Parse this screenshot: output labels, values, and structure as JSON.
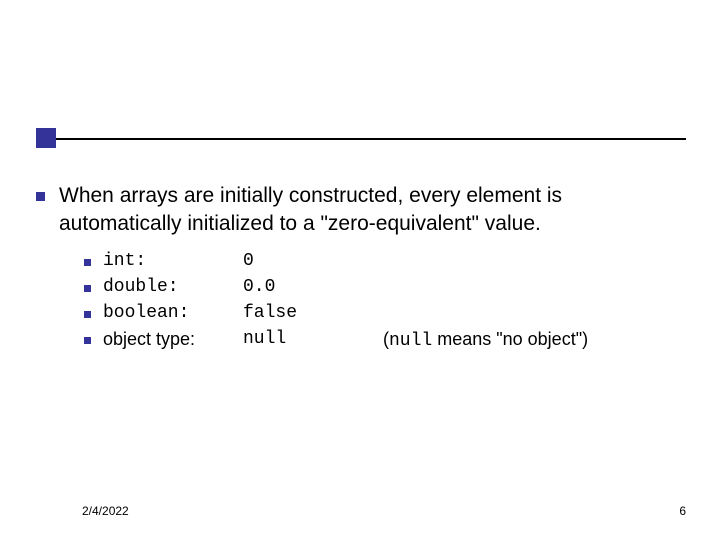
{
  "accent_color": "#333399",
  "main": {
    "text": "When arrays are initially constructed, every element is automatically initialized to a \"zero-equivalent\" value."
  },
  "rows": [
    {
      "type_label": "int:",
      "type_mono": true,
      "value": "0",
      "note_prefix": "",
      "note_mono": "",
      "note_suffix": ""
    },
    {
      "type_label": "double:",
      "type_mono": true,
      "value": "0.0",
      "note_prefix": "",
      "note_mono": "",
      "note_suffix": ""
    },
    {
      "type_label": "boolean:",
      "type_mono": true,
      "value": "false",
      "note_prefix": "",
      "note_mono": "",
      "note_suffix": ""
    },
    {
      "type_label": "object type:",
      "type_mono": false,
      "value": "null",
      "note_prefix": "(",
      "note_mono": "null",
      "note_suffix": " means \"no object\")"
    }
  ],
  "footer": {
    "date": "2/4/2022",
    "page": "6"
  }
}
